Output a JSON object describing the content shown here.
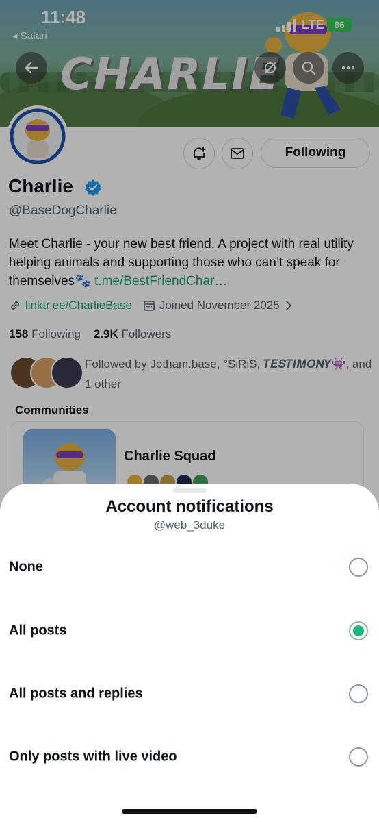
{
  "status_bar": {
    "time": "11:48",
    "back_app": "◂ Safari",
    "network": "LTE",
    "battery": "86"
  },
  "banner": {
    "title": "CHARLIE"
  },
  "profile": {
    "name": "Charlie",
    "handle": "@BaseDogCharlie",
    "bio_text": "Meet Charlie - your new best friend. A project with real utility helping animals and supporting those who can’t speak for themselves🐾",
    "bio_link": "t.me/BestFriendChar…",
    "website": "linktr.ee/CharlieBase",
    "joined": "Joined November 2025",
    "following_count": "158",
    "following_label": "Following",
    "followers_count": "2.9K",
    "followers_label": "Followers",
    "followed_by": "Followed by Jotham.base, °SiRiS, 𝑻𝑬𝑺𝑻𝑰𝑴𝑶𝑵𝒀👾, and 1 other",
    "following_button": "Following"
  },
  "communities": {
    "title": "Communities",
    "items": [
      {
        "name": "Charlie Squad"
      }
    ]
  },
  "sheet": {
    "title": "Account notifications",
    "subtitle": "@web_3duke",
    "options": [
      {
        "label": "None",
        "selected": false
      },
      {
        "label": "All posts",
        "selected": true
      },
      {
        "label": "All posts and replies",
        "selected": false
      },
      {
        "label": "Only posts with live video",
        "selected": false
      }
    ]
  },
  "colors": {
    "accent_green": "#1fb47d",
    "link_green": "#1b9f6a",
    "verified_blue": "#1d9bf0",
    "battery_green": "#34c759"
  },
  "icons": [
    "back-arrow-icon",
    "eye-off-icon",
    "search-icon",
    "more-icon",
    "bell-plus-icon",
    "mail-icon",
    "verified-icon",
    "link-icon",
    "calendar-icon",
    "chevron-right-icon"
  ]
}
